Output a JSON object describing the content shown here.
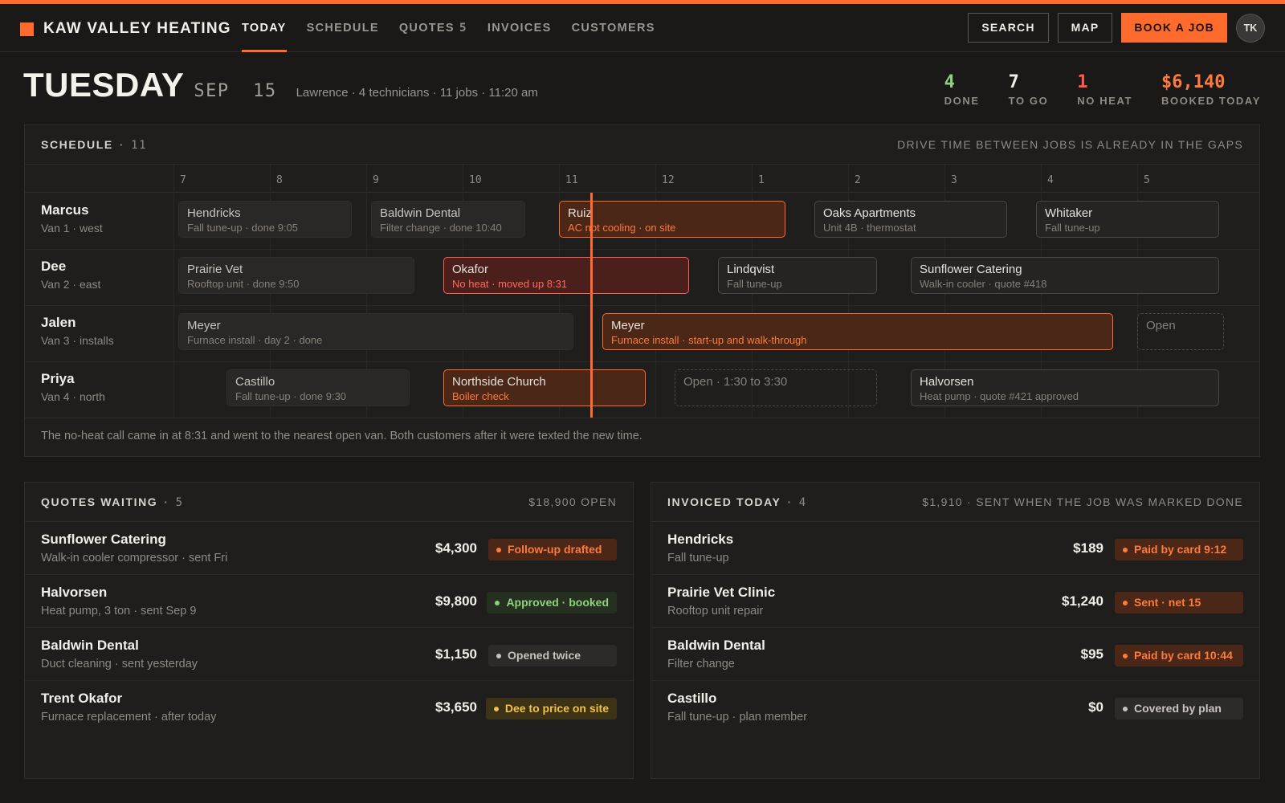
{
  "colors": {
    "accent": "#ff6b2c",
    "done": "#8fd17f",
    "no_heat": "#ff5a4e",
    "booked": "#ff7a3d"
  },
  "brand": {
    "name": "KAW VALLEY HEATING",
    "mark": "orange-square-logo"
  },
  "nav": [
    {
      "label": "TODAY",
      "count": "",
      "active": true
    },
    {
      "label": "SCHEDULE",
      "count": ""
    },
    {
      "label": "QUOTES",
      "count": "5"
    },
    {
      "label": "INVOICES",
      "count": ""
    },
    {
      "label": "CUSTOMERS",
      "count": ""
    }
  ],
  "actions": {
    "search": "SEARCH",
    "map": "MAP",
    "book": "BOOK A JOB",
    "avatar": "TK"
  },
  "day": {
    "name": "TUESDAY",
    "date": "SEP  15",
    "meta": "Lawrence · 4 technicians · 11 jobs · 11:20 am"
  },
  "stats": [
    {
      "value": "4",
      "label": "DONE",
      "color": "#8fd17f"
    },
    {
      "value": "7",
      "label": "TO GO",
      "color": "#f2eee8"
    },
    {
      "value": "1",
      "label": "NO HEAT",
      "color": "#ff5a4e"
    },
    {
      "value": "$6,140",
      "label": "BOOKED TODAY",
      "color": "#ff7a3d"
    }
  ],
  "schedule": {
    "title": "SCHEDULE",
    "count": "11",
    "note": "DRIVE TIME BETWEEN JOBS IS ALREADY IN THE GAPS",
    "hours": [
      "7",
      "8",
      "9",
      "10",
      "11",
      "12",
      "1",
      "2",
      "3",
      "4",
      "5"
    ],
    "now": "11:20",
    "technicians": [
      {
        "name": "Marcus",
        "sub": "Van 1 · west",
        "jobs": [
          {
            "title": "Hendricks",
            "sub": "Fall tune-up · done 9:05",
            "status": "done",
            "start": 7.0,
            "end": 8.9
          },
          {
            "title": "Baldwin Dental",
            "sub": "Filter change · done 10:40",
            "status": "done",
            "start": 9.0,
            "end": 10.7
          },
          {
            "title": "Ruiz",
            "sub": "AC not cooling · on site",
            "status": "active",
            "start": 10.95,
            "end": 13.4
          },
          {
            "title": "Oaks Apartments",
            "sub": "Unit 4B · thermostat",
            "status": "upcoming",
            "start": 13.6,
            "end": 15.7
          },
          {
            "title": "Whitaker",
            "sub": "Fall tune-up",
            "status": "upcoming",
            "start": 15.9,
            "end": 17.9
          }
        ]
      },
      {
        "name": "Dee",
        "sub": "Van 2 · east",
        "jobs": [
          {
            "title": "Prairie Vet",
            "sub": "Rooftop unit · done 9:50",
            "status": "done",
            "start": 7.0,
            "end": 9.55
          },
          {
            "title": "Okafor",
            "sub": "No heat · moved up 8:31",
            "status": "urgent",
            "start": 9.75,
            "end": 12.4
          },
          {
            "title": "Lindqvist",
            "sub": "Fall tune-up",
            "status": "upcoming",
            "start": 12.6,
            "end": 14.35
          },
          {
            "title": "Sunflower Catering",
            "sub": "Walk-in cooler · quote #418",
            "status": "upcoming",
            "start": 14.6,
            "end": 17.9
          }
        ]
      },
      {
        "name": "Jalen",
        "sub": "Van 3 · installs",
        "jobs": [
          {
            "title": "Meyer",
            "sub": "Furnace install · day 2 · done",
            "status": "done",
            "start": 7.0,
            "end": 11.2
          },
          {
            "title": "Meyer",
            "sub": "Furnace install · start-up and walk-through",
            "status": "active",
            "start": 11.4,
            "end": 16.8
          },
          {
            "title": "Open",
            "sub": "",
            "status": "open",
            "start": 16.95,
            "end": 17.95
          }
        ]
      },
      {
        "name": "Priya",
        "sub": "Van 4 · north",
        "jobs": [
          {
            "title": "Castillo",
            "sub": "Fall tune-up · done 9:30",
            "status": "done",
            "start": 7.5,
            "end": 9.5
          },
          {
            "title": "Northside Church",
            "sub": "Boiler check",
            "status": "active",
            "start": 9.75,
            "end": 11.95
          },
          {
            "title": "Open · 1:30 to 3:30",
            "sub": "",
            "status": "open",
            "start": 12.15,
            "end": 14.35
          },
          {
            "title": "Halvorsen",
            "sub": "Heat pump · quote #421 approved",
            "status": "upcoming",
            "start": 14.6,
            "end": 17.9
          }
        ]
      }
    ],
    "footnote": "The no-heat call came in at 8:31 and went to the nearest open van. Both customers after it were texted the new time."
  },
  "quotes": {
    "title": "QUOTES WAITING",
    "count": "5",
    "note": "$18,900 OPEN",
    "items": [
      {
        "name": "Sunflower Catering",
        "sub": "Walk-in cooler compressor · sent Fri",
        "amount": "$4,300",
        "status": "Follow-up drafted",
        "tone": "orange"
      },
      {
        "name": "Halvorsen",
        "sub": "Heat pump, 3 ton · sent Sep 9",
        "amount": "$9,800",
        "status": "Approved · booked",
        "tone": "green"
      },
      {
        "name": "Baldwin Dental",
        "sub": "Duct cleaning · sent yesterday",
        "amount": "$1,150",
        "status": "Opened twice",
        "tone": "gray"
      },
      {
        "name": "Trent Okafor",
        "sub": "Furnace replacement · after today",
        "amount": "$3,650",
        "status": "Dee to price on site",
        "tone": "yellow"
      }
    ]
  },
  "invoices": {
    "title": "INVOICED TODAY",
    "count": "4",
    "note": "$1,910 · SENT WHEN THE JOB WAS MARKED DONE",
    "items": [
      {
        "name": "Hendricks",
        "sub": "Fall tune-up",
        "amount": "$189",
        "status": "Paid by card 9:12",
        "tone": "orange"
      },
      {
        "name": "Prairie Vet Clinic",
        "sub": "Rooftop unit repair",
        "amount": "$1,240",
        "status": "Sent · net 15",
        "tone": "orange"
      },
      {
        "name": "Baldwin Dental",
        "sub": "Filter change",
        "amount": "$95",
        "status": "Paid by card 10:44",
        "tone": "orange"
      },
      {
        "name": "Castillo",
        "sub": "Fall tune-up · plan member",
        "amount": "$0",
        "status": "Covered by plan",
        "tone": "gray"
      }
    ]
  }
}
